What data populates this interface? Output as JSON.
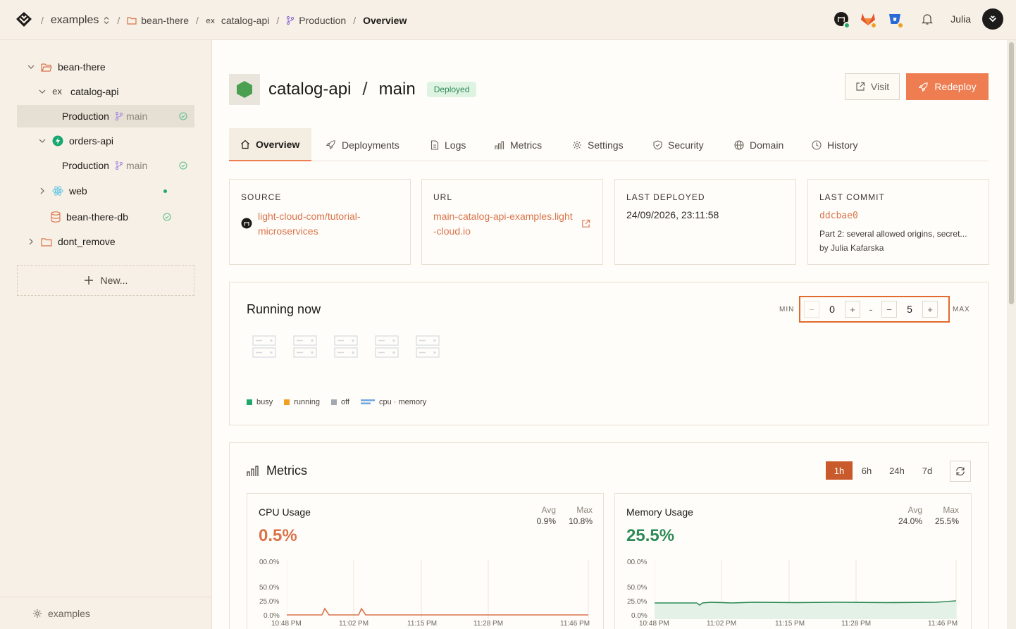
{
  "header": {
    "breadcrumb": {
      "workspace": "examples",
      "project": "bean-there",
      "service": "catalog-api",
      "environment": "Production",
      "page": "Overview"
    },
    "user_name": "Julia"
  },
  "sidebar": {
    "tree": {
      "project_1": "bean-there",
      "service_1": "catalog-api",
      "env_1": "Production",
      "env_1_branch": "main",
      "service_2": "orders-api",
      "env_2": "Production",
      "env_2_branch": "main",
      "service_3": "web",
      "database": "bean-there-db",
      "project_2": "dont_remove"
    },
    "new_label": "New...",
    "footer_label": "examples"
  },
  "service": {
    "name": "catalog-api",
    "separator": "/",
    "branch": "main",
    "status": "Deployed",
    "visit_label": "Visit",
    "redeploy_label": "Redeploy"
  },
  "tabs": [
    "Overview",
    "Deployments",
    "Logs",
    "Metrics",
    "Settings",
    "Security",
    "Domain",
    "History"
  ],
  "info": {
    "source_label": "SOURCE",
    "source_value": "light-cloud-com/tutorial-microservices",
    "url_label": "URL",
    "url_value": "main-catalog-api-examples.light-cloud.io",
    "deployed_label": "LAST DEPLOYED",
    "deployed_value": "24/09/2026, 23:11:58",
    "commit_label": "LAST COMMIT",
    "commit_hash": "ddcbae0",
    "commit_message": "Part 2: several allowed origins, secret...",
    "commit_author": "by Julia Kafarska"
  },
  "running": {
    "title": "Running now",
    "min_label": "MIN",
    "max_label": "MAX",
    "min_value": "0",
    "max_value": "5",
    "min_dec": "−",
    "min_inc": "+",
    "mid_sep": "-",
    "max_dec": "−",
    "max_inc": "+",
    "legend": {
      "busy": "busy",
      "running": "running",
      "off": "off",
      "cpu_memory": "cpu · memory"
    },
    "instance_count": 5
  },
  "metrics": {
    "title": "Metrics",
    "ranges": [
      "1h",
      "6h",
      "24h",
      "7d"
    ],
    "selected_range": "1h",
    "cpu": {
      "title": "CPU Usage",
      "current": "0.5%",
      "avg_label": "Avg",
      "avg": "0.9%",
      "max_label": "Max",
      "max": "10.8%",
      "y_ticks": [
        "00.0%",
        "50.0%",
        "25.0%",
        "0.0%"
      ],
      "x_ticks": [
        "10:48 PM",
        "11:02 PM",
        "11:15 PM",
        "11:28 PM",
        "11:46 PM"
      ]
    },
    "memory": {
      "title": "Memory Usage",
      "current": "25.5%",
      "avg_label": "Avg",
      "avg": "24.0%",
      "max_label": "Max",
      "max": "25.5%",
      "y_ticks": [
        "00.0%",
        "50.0%",
        "25.0%",
        "0.0%"
      ],
      "x_ticks": [
        "10:48 PM",
        "11:02 PM",
        "11:15 PM",
        "11:28 PM",
        "11:46 PM"
      ]
    }
  },
  "colors": {
    "accent": "#ee7d52",
    "cpu_line": "#d9734a",
    "memory_line": "#2e8b57",
    "busy": "#20a86b",
    "running": "#f0a020",
    "off": "#a4a8b0",
    "deployed": "#2e8b57"
  }
}
